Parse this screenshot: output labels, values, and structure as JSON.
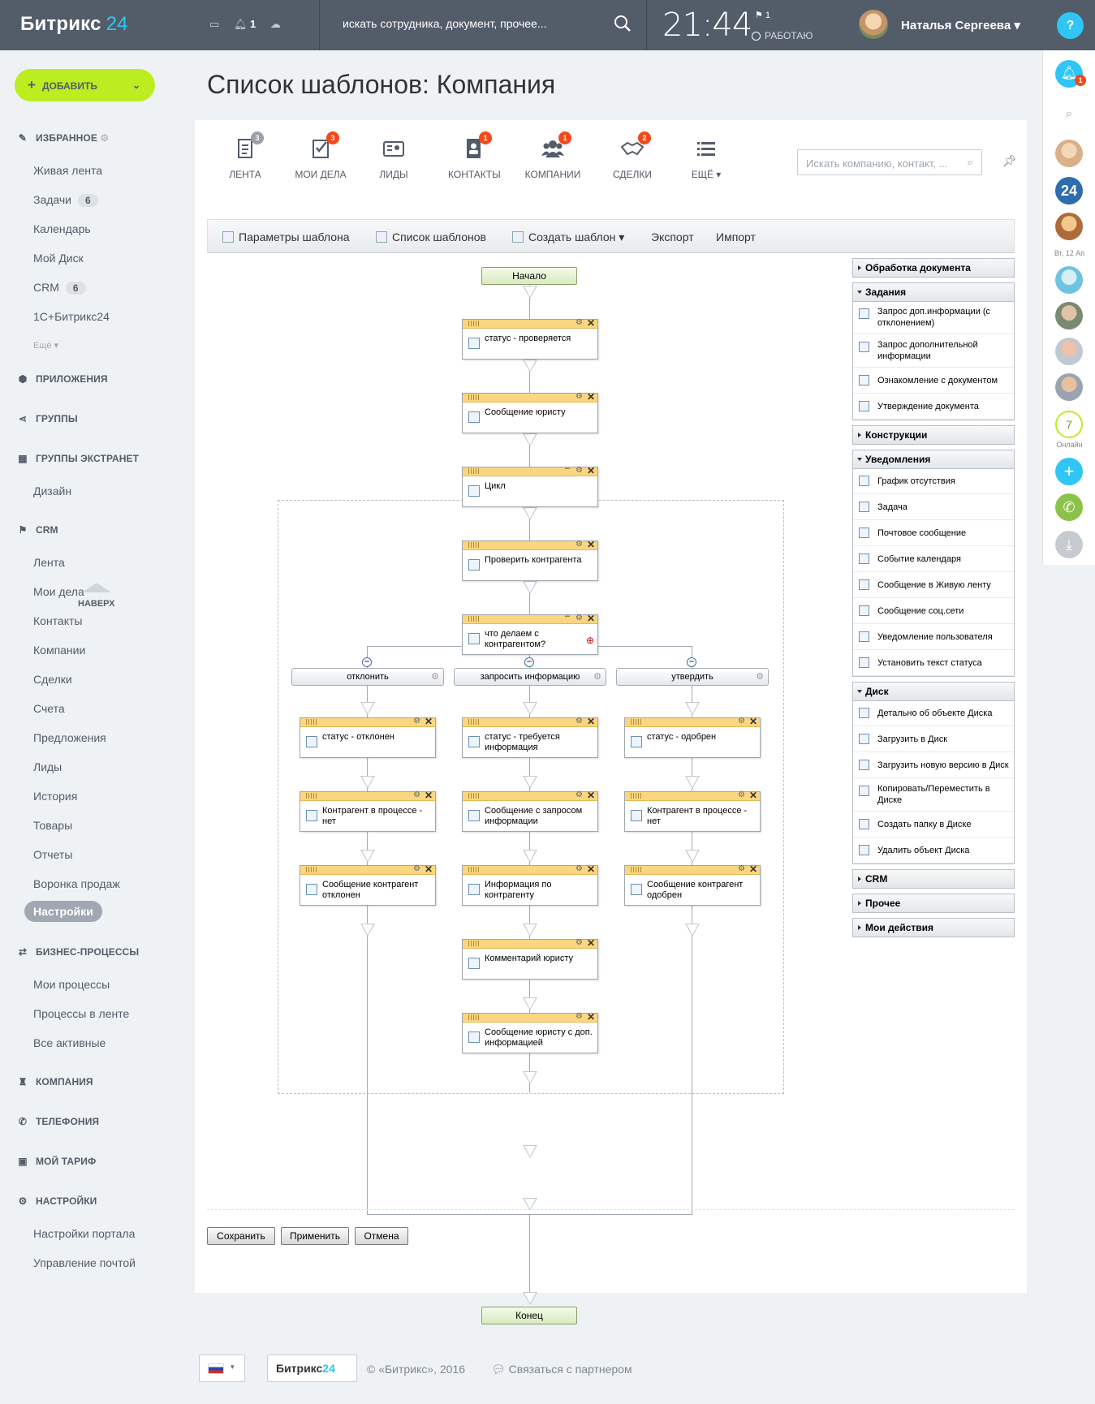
{
  "header": {
    "logo": "Битрикс",
    "logo_num": "24",
    "notif_count": "1",
    "search_placeholder": "искать сотрудника, документ, прочее...",
    "time": "21:44",
    "flag_count": "1",
    "status": "РАБОТАЮ",
    "user": "Наталья Сергеева",
    "help": "?"
  },
  "sidebar": {
    "add": "ДОБАВИТЬ",
    "fav": "ИЗБРАННОЕ",
    "fav_items": [
      {
        "label": "Живая лента"
      },
      {
        "label": "Задачи",
        "count": "6"
      },
      {
        "label": "Календарь"
      },
      {
        "label": "Мой Диск"
      },
      {
        "label": "CRM",
        "count": "6"
      },
      {
        "label": "1С+Битрикс24"
      }
    ],
    "more": "Ещё ▾",
    "apps": "ПРИЛОЖЕНИЯ",
    "groups": "ГРУППЫ",
    "extranet": "ГРУППЫ ЭКСТРАНЕТ",
    "extranet_items": [
      "Дизайн"
    ],
    "crm": "CRM",
    "crm_items": [
      "Лента",
      "Мои дела",
      "Контакты",
      "Компании",
      "Сделки",
      "Счета",
      "Предложения",
      "Лиды",
      "История",
      "Товары",
      "Отчеты",
      "Воронка продаж",
      "Настройки"
    ],
    "up": "НАВЕРХ",
    "bp": "БИЗНЕС-ПРОЦЕССЫ",
    "bp_items": [
      "Мои процессы",
      "Процессы в ленте",
      "Все активные"
    ],
    "company": "КОМПАНИЯ",
    "telephony": "ТЕЛЕФОНИЯ",
    "tariff": "МОЙ ТАРИФ",
    "settings": "НАСТРОЙКИ",
    "settings_items": [
      "Настройки портала",
      "Управление почтой"
    ]
  },
  "rightbar": {
    "notif": "1",
    "b24": "24",
    "date": "Вт, 12 Ап",
    "online_count": "7",
    "online": "Онлайн"
  },
  "page": {
    "title": "Список шаблонов: Компания"
  },
  "tabs": [
    {
      "label": "ЛЕНТА",
      "badge": "3"
    },
    {
      "label": "МОИ ДЕЛА",
      "badge": "3"
    },
    {
      "label": "ЛИДЫ"
    },
    {
      "label": "КОНТАКТЫ",
      "badge": "1"
    },
    {
      "label": "КОМПАНИИ",
      "badge": "1"
    },
    {
      "label": "СДЕЛКИ",
      "badge": "2"
    },
    {
      "label": "ЕЩЁ ▾"
    }
  ],
  "crm_search": "Искать компанию, контакт, ...",
  "toolbar": [
    "Параметры шаблона",
    "Список шаблонов",
    "Создать шаблон ▾",
    "Экспорт",
    "Импорт"
  ],
  "flow": {
    "start": "Начало",
    "end": "Конец",
    "n1": "статус - проверяется",
    "n2": "Сообщение юристу",
    "n3": "Цикл",
    "n4": "Проверить контрагента",
    "n5": "что делаем с контрагентом?",
    "branches": [
      "отклонить",
      "запросить информацию",
      "утвердить"
    ],
    "left": [
      "статус - отклонен",
      "Контрагент в процессе - нет",
      "Сообщение контрагент отклонен"
    ],
    "mid": [
      "статус - требуется информация",
      "Сообщение с запросом информации",
      "Информация по контрагенту",
      "Комментарий юристу",
      "Сообщение юристу с доп. информацией"
    ],
    "right": [
      "статус - одобрен",
      "Контрагент в процессе - нет",
      "Сообщение контрагент одобрен"
    ]
  },
  "palette": {
    "doc": "Обработка документа",
    "tasks": "Задания",
    "task_items": [
      "Запрос доп.информации (с отклонением)",
      "Запрос дополнительной информации",
      "Ознакомление с документом",
      "Утверждение документа"
    ],
    "constr": "Конструкции",
    "notif": "Уведомления",
    "notif_items": [
      "График отсутствия",
      "Задача",
      "Почтовое сообщение",
      "Событие календаря",
      "Сообщение в Живую ленту",
      "Сообщение соц.сети",
      "Уведомление пользователя",
      "Установить текст статуса"
    ],
    "disk": "Диск",
    "disk_items": [
      "Детально об объекте Диска",
      "Загрузить в Диск",
      "Загрузить новую версию в Диск",
      "Копировать/Переместить в Диске",
      "Создать папку в Диске",
      "Удалить объект Диска"
    ],
    "crm": "CRM",
    "other": "Прочее",
    "mine": "Мои действия"
  },
  "buttons": {
    "save": "Сохранить",
    "apply": "Применить",
    "cancel": "Отмена"
  },
  "footer": {
    "logo": "Битрикс",
    "logo_num": "24",
    "copy": "© «Битрикс», 2016",
    "partner": "Связаться с партнером"
  }
}
